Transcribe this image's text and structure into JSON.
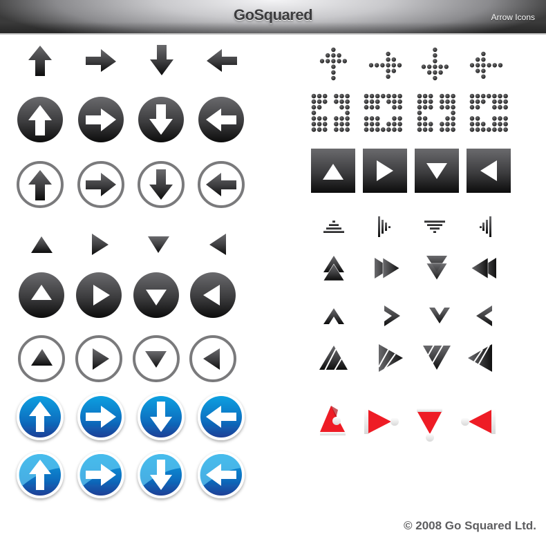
{
  "header": {
    "brand": "GoSquared",
    "subtitle": "Arrow Icons"
  },
  "footer": {
    "copyright": "© 2008 Go Squared Ltd."
  },
  "directions": [
    "up",
    "right",
    "down",
    "left"
  ],
  "icon_sets": {
    "left_column": [
      {
        "set": "plain-arrows",
        "style": "dark-gradient"
      },
      {
        "set": "dark-circle-arrows",
        "style": "dark-gradient-circle-white-arrow"
      },
      {
        "set": "outline-circle-arrows",
        "style": "grey-ring-dark-arrow"
      },
      {
        "set": "plain-triangles",
        "style": "dark-gradient"
      },
      {
        "set": "dark-circle-triangles",
        "style": "dark-gradient-circle-white-triangle"
      },
      {
        "set": "outline-circle-triangles",
        "style": "grey-ring-dark-triangle"
      },
      {
        "set": "blue-circle-arrows",
        "style": "blue-sign"
      },
      {
        "set": "blue-glossy-circle-arrows",
        "style": "blue-sign-glossy"
      }
    ],
    "right_column": [
      {
        "set": "dotted-arrows",
        "style": "dot-matrix"
      },
      {
        "set": "dotted-square-arrows",
        "style": "dot-matrix-square"
      },
      {
        "set": "dark-square-triangles",
        "style": "dark-gradient-square-white-triangle"
      },
      {
        "set": "bar-stack-arrows",
        "style": "dark-gradient"
      },
      {
        "set": "double-triangles",
        "style": "dark-gradient"
      },
      {
        "set": "chevrons",
        "style": "dark-gradient"
      },
      {
        "set": "striped-triangles",
        "style": "dark-gradient"
      },
      {
        "set": "santa-hat-arrows",
        "style": "red-white"
      }
    ]
  },
  "colors": {
    "dark_top": "#6a6a6d",
    "dark_bottom": "#0c0c0c",
    "ring": "#7a7a7c",
    "blue_top": "#0aa0e0",
    "blue_bottom": "#1e3f96",
    "santa_red": "#ee1c25",
    "footer_text": "#5e5e60"
  }
}
